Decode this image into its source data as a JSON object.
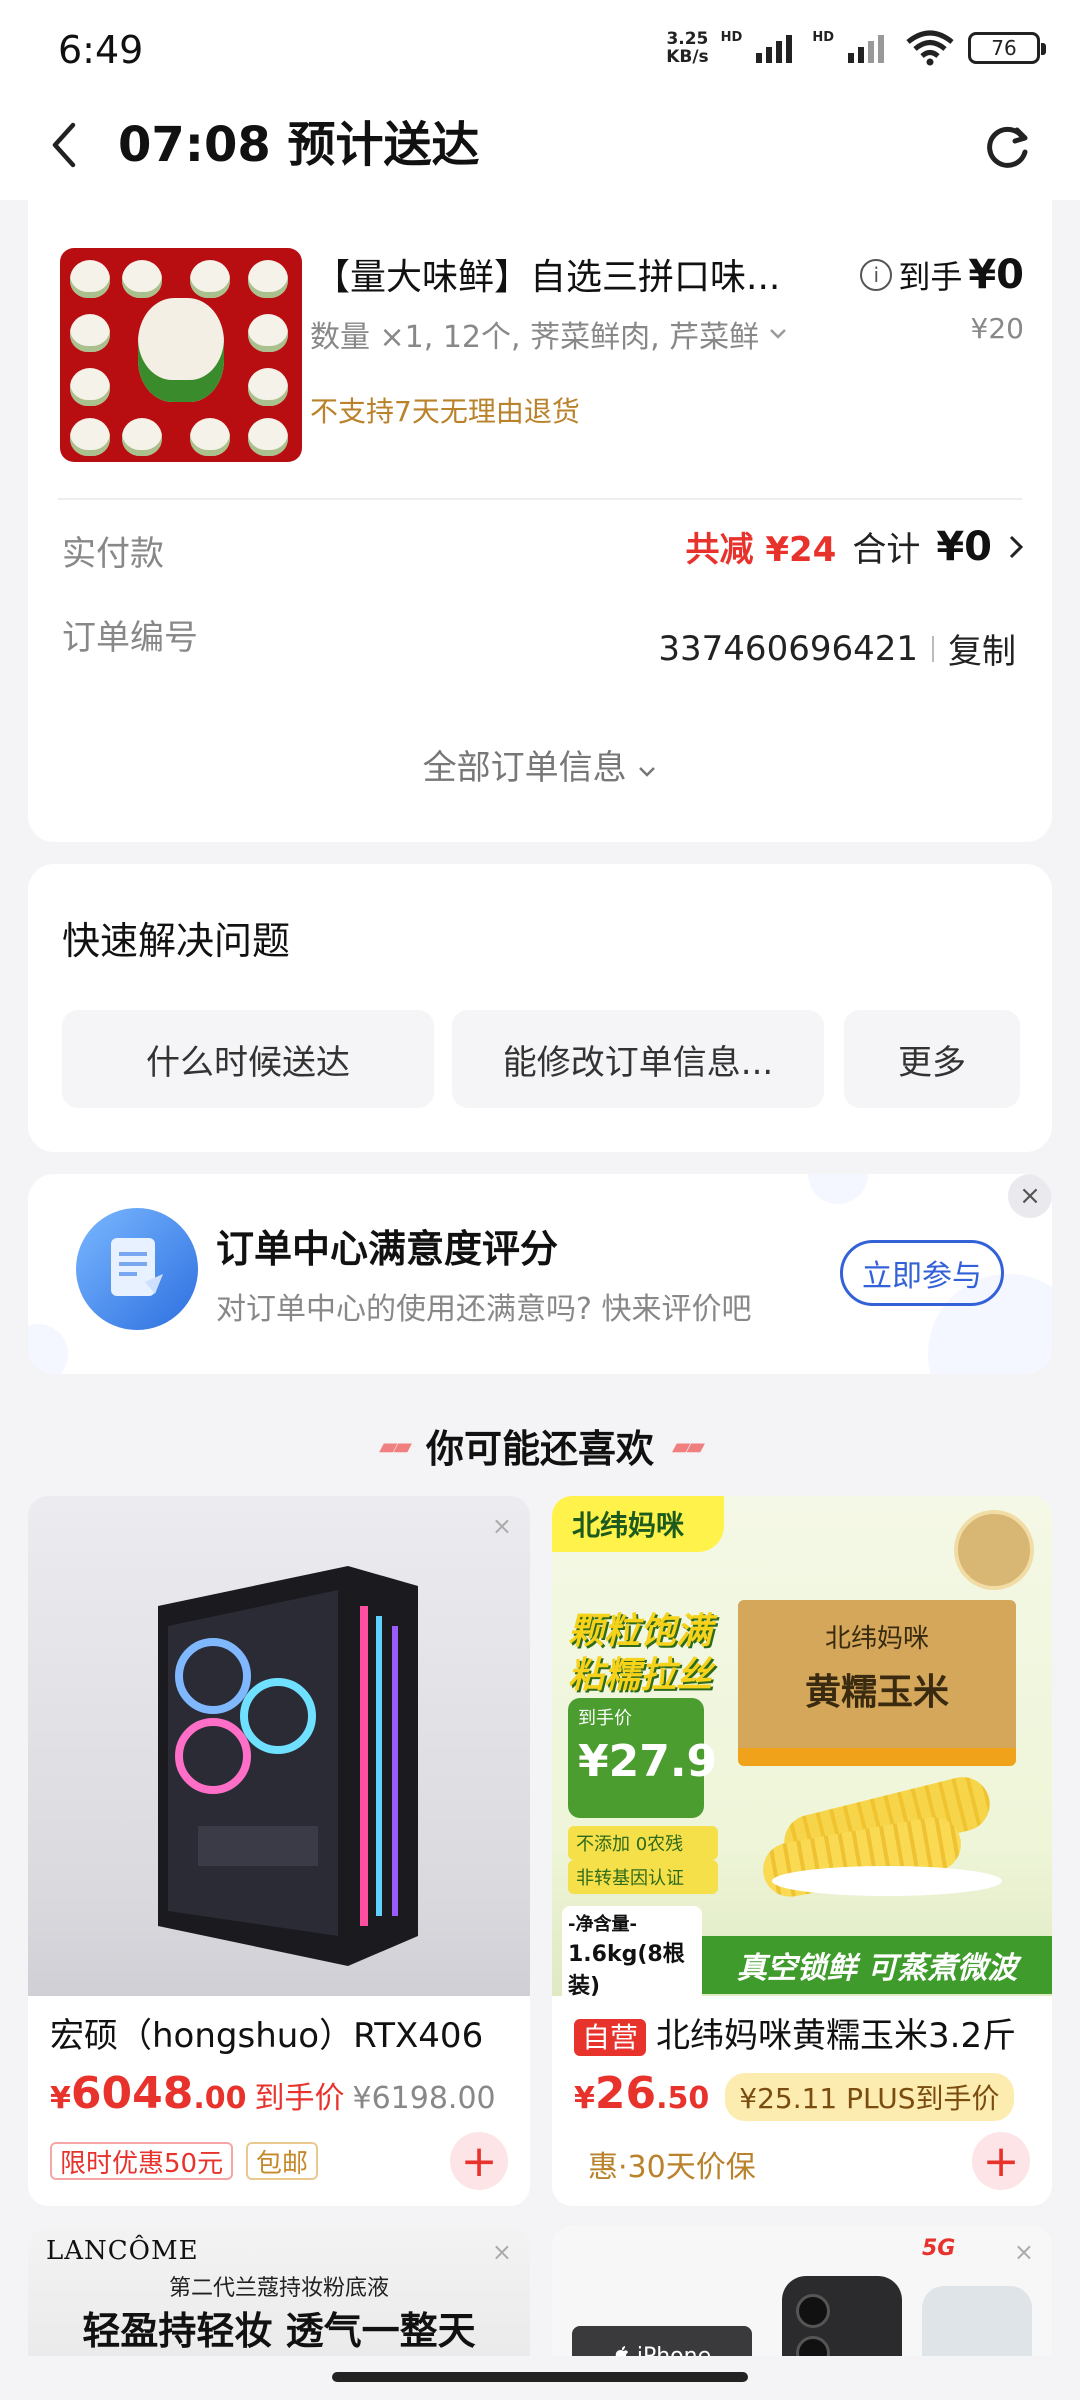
{
  "status_bar": {
    "time": "6:49",
    "speed_value": "3.25",
    "speed_unit": "KB/s",
    "hd1": "HD",
    "hd2": "HD",
    "battery": "76"
  },
  "header": {
    "title": "07:08 预计送达"
  },
  "order": {
    "product_title": "【量大味鲜】自选三拼口味...",
    "product_spec": "数量 ×1, 12个, 荠菜鲜肉, 芹菜鲜",
    "product_warning": "不支持7天无理由退货",
    "price_label": "到手",
    "price_value": "¥0",
    "price_original": "¥20",
    "paid_label": "实付款",
    "discount_text": "共减 ¥24",
    "total_label": "合计",
    "total_value": "¥0",
    "order_no_label": "订单编号",
    "order_no": "337460696421",
    "copy_label": "复制",
    "all_info_label": "全部订单信息"
  },
  "quick": {
    "title": "快速解决问题",
    "buttons": [
      "什么时候送达",
      "能修改订单信息...",
      "更多"
    ]
  },
  "survey": {
    "title": "订单中心满意度评分",
    "subtitle": "对订单中心的使用还满意吗? 快来评价吧",
    "join_label": "立即参与"
  },
  "recommend": {
    "heading": "你可能还喜欢",
    "products": [
      {
        "name": "宏硕（hongshuo）RTX406",
        "yen": "¥",
        "price_int": "6048",
        "price_dec": ".00",
        "price_tag": "到手价",
        "price_strike": "¥6198.00",
        "chips": [
          "限时优惠50元",
          "包邮"
        ]
      },
      {
        "badge": "自营",
        "name": "北纬妈咪黄糯玉米3.2斤",
        "yen": "¥",
        "price_int": "26",
        "price_dec": ".50",
        "plus_price": "¥25.11 PLUS到手价",
        "sub_note": "惠·30天价保",
        "brand": "北纬妈咪",
        "img_box_brand": "北纬妈咪",
        "img_box_title": "黄糯玉米",
        "img_slogan1": "颗粒饱满",
        "img_slogan2": "粘糯拉丝",
        "img_price_label": "到手价",
        "img_price": "¥27.9",
        "img_tag1": "不添加  0农残",
        "img_tag2": "非转基因认证",
        "img_weight_label": "-净含量-",
        "img_weight": "1.6kg(8根装)",
        "img_bottom": "真空锁鲜 可蒸煮微波"
      }
    ],
    "bottom_left_brand": "LANCÔME",
    "bottom_left_line1": "第二代兰蔻持妆粉底液",
    "bottom_left_line2": "轻盈持轻妆 透气一整天",
    "bottom_right_tag": "5G",
    "bottom_right_phone": "iPhone"
  }
}
